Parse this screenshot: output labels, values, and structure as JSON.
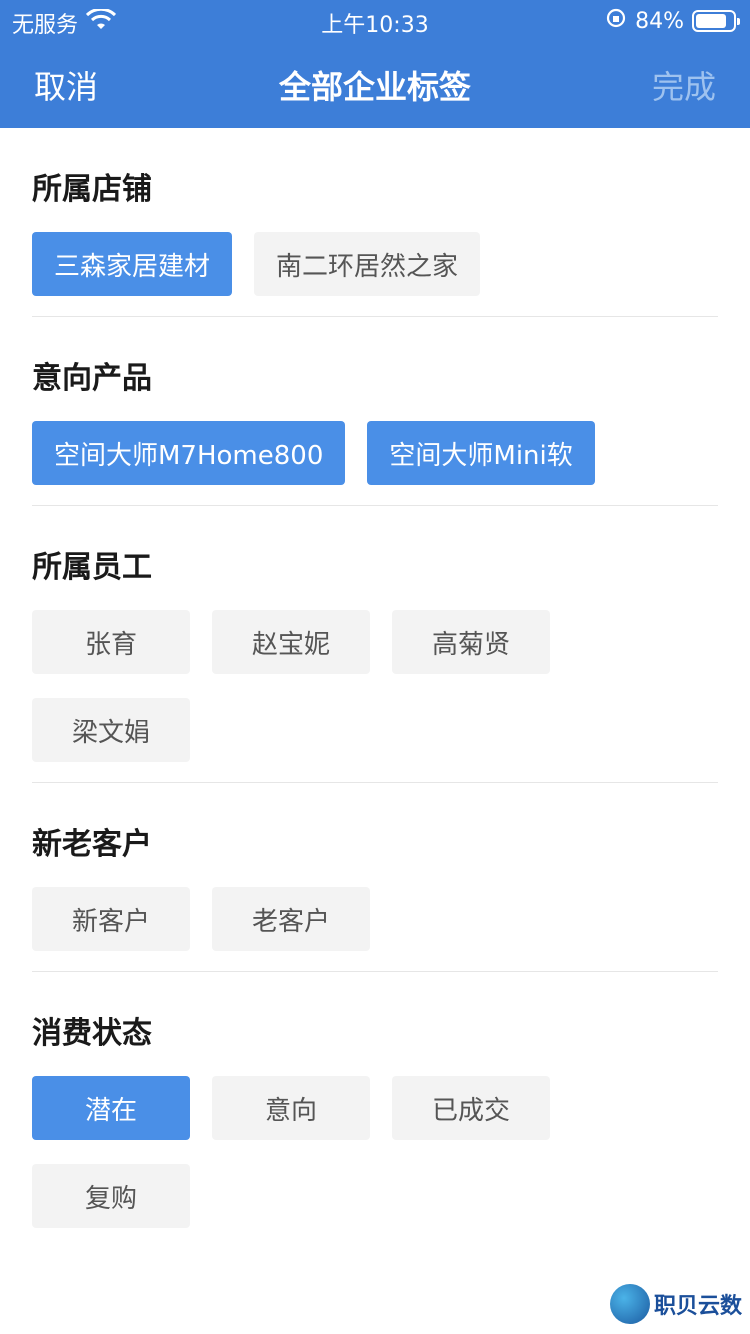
{
  "status_bar": {
    "carrier": "无服务",
    "time": "上午10:33",
    "battery": "84%",
    "battery_level": 0.84,
    "icons": [
      "wifi-icon",
      "orientation-lock-icon",
      "battery-icon"
    ]
  },
  "nav": {
    "cancel": "取消",
    "title": "全部企业标签",
    "done": "完成"
  },
  "colors": {
    "header": "#3d7ed8",
    "selected_tag": "#4a8fe7",
    "tag_bg": "#f3f3f3",
    "done_disabled": "#9ec2ef"
  },
  "sections": [
    {
      "title": "所属店铺",
      "tags": [
        {
          "label": "三森家居建材",
          "selected": true
        },
        {
          "label": "南二环居然之家",
          "selected": false
        }
      ]
    },
    {
      "title": "意向产品",
      "tags": [
        {
          "label": "空间大师M7Home800",
          "selected": true
        },
        {
          "label": "空间大师Mini软",
          "selected": true
        }
      ]
    },
    {
      "title": "所属员工",
      "tags": [
        {
          "label": "张育",
          "selected": false
        },
        {
          "label": "赵宝妮",
          "selected": false
        },
        {
          "label": "高菊贤",
          "selected": false
        },
        {
          "label": "梁文娟",
          "selected": false
        }
      ]
    },
    {
      "title": "新老客户",
      "tags": [
        {
          "label": "新客户",
          "selected": false
        },
        {
          "label": "老客户",
          "selected": false
        }
      ]
    },
    {
      "title": "消费状态",
      "tags": [
        {
          "label": "潜在",
          "selected": true
        },
        {
          "label": "意向",
          "selected": false
        },
        {
          "label": "已成交",
          "selected": false
        },
        {
          "label": "复购",
          "selected": false
        }
      ]
    }
  ],
  "watermark": "职贝云数"
}
